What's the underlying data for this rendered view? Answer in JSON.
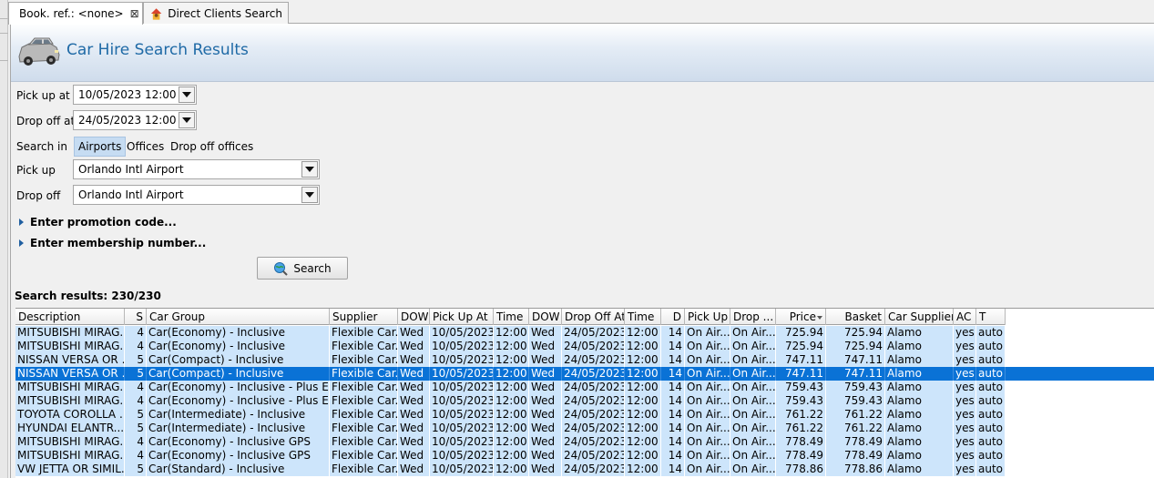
{
  "tabs": [
    {
      "label": "Book. ref.: <none>",
      "closable": true,
      "icon": "palm-tree-icon"
    },
    {
      "label": "Direct Clients Search",
      "closable": false,
      "icon": "user-house-icon"
    }
  ],
  "header": {
    "title": "Car Hire Search Results",
    "icon": "car-icon"
  },
  "form": {
    "pickup_at_label": "Pick up at",
    "pickup_at_value": "10/05/2023 12:00",
    "dropoff_at_label": "Drop off at",
    "dropoff_at_value": "24/05/2023 12:00",
    "search_in_label": "Search in",
    "search_in_options": [
      "Airports",
      "Offices",
      "Drop off offices"
    ],
    "search_in_selected": "Airports",
    "pickup_label": "Pick up",
    "pickup_value": "Orlando Intl Airport",
    "dropoff_label": "Drop off",
    "dropoff_value": "Orlando Intl Airport",
    "promo_label": "Enter promotion code...",
    "membership_label": "Enter membership number...",
    "search_button": "Search"
  },
  "results": {
    "count_label": "Search results: 230/230",
    "sorted_column": "Price",
    "columns": [
      "Description",
      "S",
      "Car Group",
      "Supplier",
      "DOW",
      "Pick Up At",
      "Time",
      "DOW",
      "Drop Off At",
      "Time",
      "D",
      "Pick Up",
      "Drop ...",
      "Price",
      "Basket",
      "Car Supplier",
      "AC",
      "T"
    ],
    "rows": [
      [
        "MITSUBISHI MIRAG...",
        "4",
        "Car(Economy) - Inclusive",
        "Flexible Car...",
        "Wed",
        "10/05/2023",
        "12:00",
        "Wed",
        "24/05/2023",
        "12:00",
        "14",
        "On Air...",
        "On Air...",
        "725.94",
        "725.94",
        "Alamo",
        "yes",
        "auto"
      ],
      [
        "MITSUBISHI MIRAG...",
        "4",
        "Car(Economy) - Inclusive",
        "Flexible Car...",
        "Wed",
        "10/05/2023",
        "12:00",
        "Wed",
        "24/05/2023",
        "12:00",
        "14",
        "On Air...",
        "On Air...",
        "725.94",
        "725.94",
        "Alamo",
        "yes",
        "auto"
      ],
      [
        "NISSAN VERSA OR ...",
        "5",
        "Car(Compact) - Inclusive",
        "Flexible Car...",
        "Wed",
        "10/05/2023",
        "12:00",
        "Wed",
        "24/05/2023",
        "12:00",
        "14",
        "On Air...",
        "On Air...",
        "747.11",
        "747.11",
        "Alamo",
        "yes",
        "auto"
      ],
      [
        "NISSAN VERSA OR ...",
        "5",
        "Car(Compact) - Inclusive",
        "Flexible Car...",
        "Wed",
        "10/05/2023",
        "12:00",
        "Wed",
        "24/05/2023",
        "12:00",
        "14",
        "On Air...",
        "On Air...",
        "747.11",
        "747.11",
        "Alamo",
        "yes",
        "auto"
      ],
      [
        "MITSUBISHI MIRAG...",
        "4",
        "Car(Economy) - Inclusive - Plus Ex...",
        "Flexible Car...",
        "Wed",
        "10/05/2023",
        "12:00",
        "Wed",
        "24/05/2023",
        "12:00",
        "14",
        "On Air...",
        "On Air...",
        "759.43",
        "759.43",
        "Alamo",
        "yes",
        "auto"
      ],
      [
        "MITSUBISHI MIRAG...",
        "4",
        "Car(Economy) - Inclusive - Plus Ex...",
        "Flexible Car...",
        "Wed",
        "10/05/2023",
        "12:00",
        "Wed",
        "24/05/2023",
        "12:00",
        "14",
        "On Air...",
        "On Air...",
        "759.43",
        "759.43",
        "Alamo",
        "yes",
        "auto"
      ],
      [
        "TOYOTA COROLLA ...",
        "5",
        "Car(Intermediate) - Inclusive",
        "Flexible Car...",
        "Wed",
        "10/05/2023",
        "12:00",
        "Wed",
        "24/05/2023",
        "12:00",
        "14",
        "On Air...",
        "On Air...",
        "761.22",
        "761.22",
        "Alamo",
        "yes",
        "auto"
      ],
      [
        "HYUNDAI ELANTR...",
        "5",
        "Car(Intermediate) - Inclusive",
        "Flexible Car...",
        "Wed",
        "10/05/2023",
        "12:00",
        "Wed",
        "24/05/2023",
        "12:00",
        "14",
        "On Air...",
        "On Air...",
        "761.22",
        "761.22",
        "Alamo",
        "yes",
        "auto"
      ],
      [
        "MITSUBISHI MIRAG...",
        "4",
        "Car(Economy) - Inclusive GPS",
        "Flexible Car...",
        "Wed",
        "10/05/2023",
        "12:00",
        "Wed",
        "24/05/2023",
        "12:00",
        "14",
        "On Air...",
        "On Air...",
        "778.49",
        "778.49",
        "Alamo",
        "yes",
        "auto"
      ],
      [
        "MITSUBISHI MIRAG...",
        "4",
        "Car(Economy) - Inclusive GPS",
        "Flexible Car...",
        "Wed",
        "10/05/2023",
        "12:00",
        "Wed",
        "24/05/2023",
        "12:00",
        "14",
        "On Air...",
        "On Air...",
        "778.49",
        "778.49",
        "Alamo",
        "yes",
        "auto"
      ],
      [
        "VW JETTA OR SIMIL...",
        "5",
        "Car(Standard) - Inclusive",
        "Flexible Car...",
        "Wed",
        "10/05/2023",
        "12:00",
        "Wed",
        "24/05/2023",
        "12:00",
        "14",
        "On Air...",
        "On Air...",
        "778.86",
        "778.86",
        "Alamo",
        "yes",
        "auto"
      ]
    ],
    "selected_row": 3
  },
  "colors": {
    "accent": "#1f6aa6",
    "row_bg": "#cde5fb",
    "row_selected": "#0a72d6",
    "segment_selected": "#c6dcf2"
  }
}
